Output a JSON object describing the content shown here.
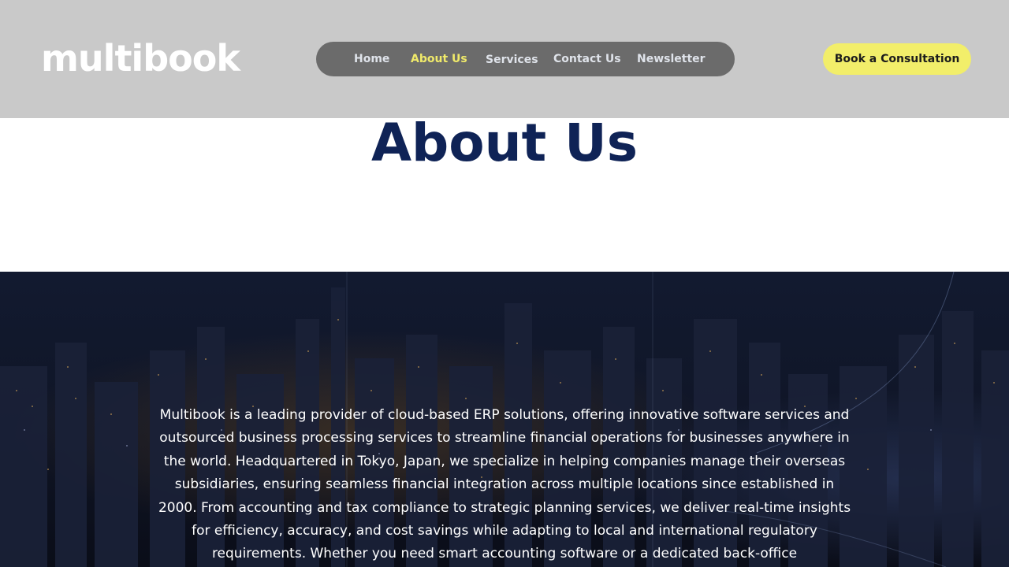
{
  "brand": {
    "name": "multibook"
  },
  "nav": {
    "items": [
      {
        "label": "Home",
        "active": false
      },
      {
        "label": "About Us",
        "active": true
      },
      {
        "label": "Services",
        "active": false
      },
      {
        "label": "Contact Us",
        "active": false
      },
      {
        "label": "Newsletter",
        "active": false
      }
    ]
  },
  "cta": {
    "label": "Book a Consultation"
  },
  "page": {
    "title": "About Us"
  },
  "about": {
    "text": "Multibook is a leading provider of cloud-based ERP solutions, offering innovative software services and outsourced business processing services to streamline financial operations for businesses anywhere in the world. Headquartered in Tokyo, Japan, we specialize in helping companies manage their overseas subsidiaries, ensuring seamless financial integration across multiple locations since established in 2000. From accounting and tax compliance to strategic planning services, we deliver real-time insights for efficiency, accuracy, and cost savings while adapting to local and international regulatory requirements. Whether you need smart accounting software or a dedicated back-office"
  },
  "colors": {
    "header_bg": "#c9c9c9",
    "nav_bg": "#6b6b6b",
    "nav_active": "#f0ea6a",
    "cta_bg": "#f2ee6a",
    "title": "#0f2356",
    "hero_bg": "#0c1020"
  }
}
